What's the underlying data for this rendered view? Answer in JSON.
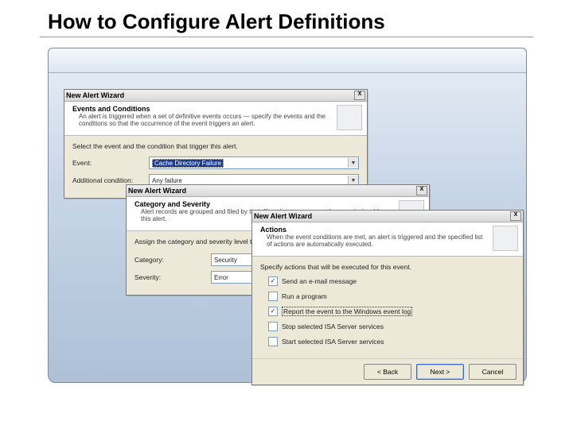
{
  "slide": {
    "title": "How to Configure Alert Definitions"
  },
  "wizard_title": "New Alert Wizard",
  "close_x": "X",
  "dd_arrow": "▼",
  "dlg1": {
    "header_title": "Events and Conditions",
    "header_desc": "An alert is triggered when a set of definitive events occurs — specify the events and the conditions so that the occurrence of the event triggers an alert.",
    "prompt": "Select the event and the condition that trigger this alert.",
    "event_label": "Event:",
    "event_value": "Cache Directory Failure",
    "cond_label": "Additional condition:",
    "cond_value": "Any failure"
  },
  "dlg2": {
    "header_title": "Category and Severity",
    "header_desc": "Alert records are grouped and filed by their file scheme — you set the severity level for this alert.",
    "prompt": "Assign the category and severity level to this alert.",
    "cat_label": "Category:",
    "cat_value": "Security",
    "sev_label": "Severity:",
    "sev_value": "Error"
  },
  "dlg3": {
    "header_title": "Actions",
    "header_desc": "When the event conditions are met, an alert is triggered and the specified list of actions are automatically executed.",
    "prompt": "Specify actions that will be executed for this event.",
    "actions": {
      "a1": "Send an e-mail message",
      "a2": "Run a program",
      "a3": "Report the event to the Windows event log",
      "a4": "Stop selected ISA Server services",
      "a5": "Start selected ISA Server services"
    },
    "buttons": {
      "back": "< Back",
      "next": "Next >",
      "cancel": "Cancel"
    }
  }
}
